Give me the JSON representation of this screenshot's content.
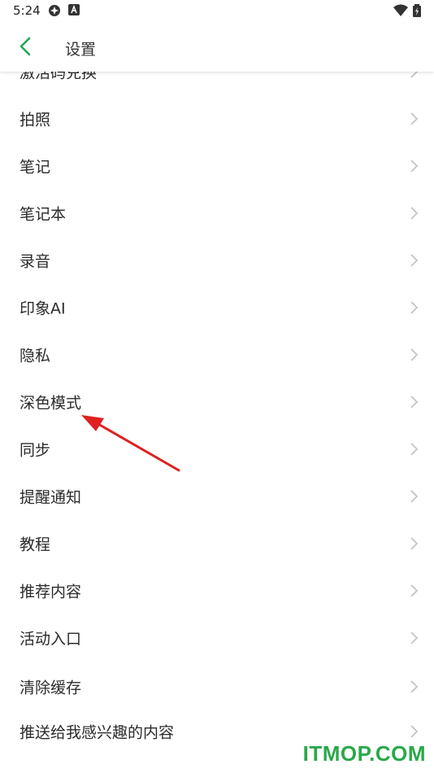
{
  "status_bar": {
    "time": "5:24",
    "icons": [
      "settings-sync-icon",
      "accessibility-a-icon",
      "wifi-icon",
      "battery-charging-icon"
    ]
  },
  "header": {
    "title": "设置",
    "back_icon": "chevron-left-icon",
    "accent_color": "#1fa84f"
  },
  "settings_list": {
    "items": [
      {
        "label": "激活码兑换"
      },
      {
        "label": "拍照"
      },
      {
        "label": "笔记"
      },
      {
        "label": "笔记本"
      },
      {
        "label": "录音"
      },
      {
        "label": "印象AI"
      },
      {
        "label": "隐私"
      },
      {
        "label": "深色模式"
      },
      {
        "label": "同步"
      },
      {
        "label": "提醒通知"
      },
      {
        "label": "教程"
      },
      {
        "label": "推荐内容"
      },
      {
        "label": "活动入口"
      },
      {
        "label": "清除缓存"
      },
      {
        "label": "推送给我感兴趣的内容"
      }
    ],
    "chevron_icon": "chevron-right-icon"
  },
  "annotation": {
    "arrow_color": "#e02020",
    "points_to": "深色模式"
  },
  "watermark": {
    "text": "ITMOP.COM",
    "color": "#2aa84a"
  }
}
